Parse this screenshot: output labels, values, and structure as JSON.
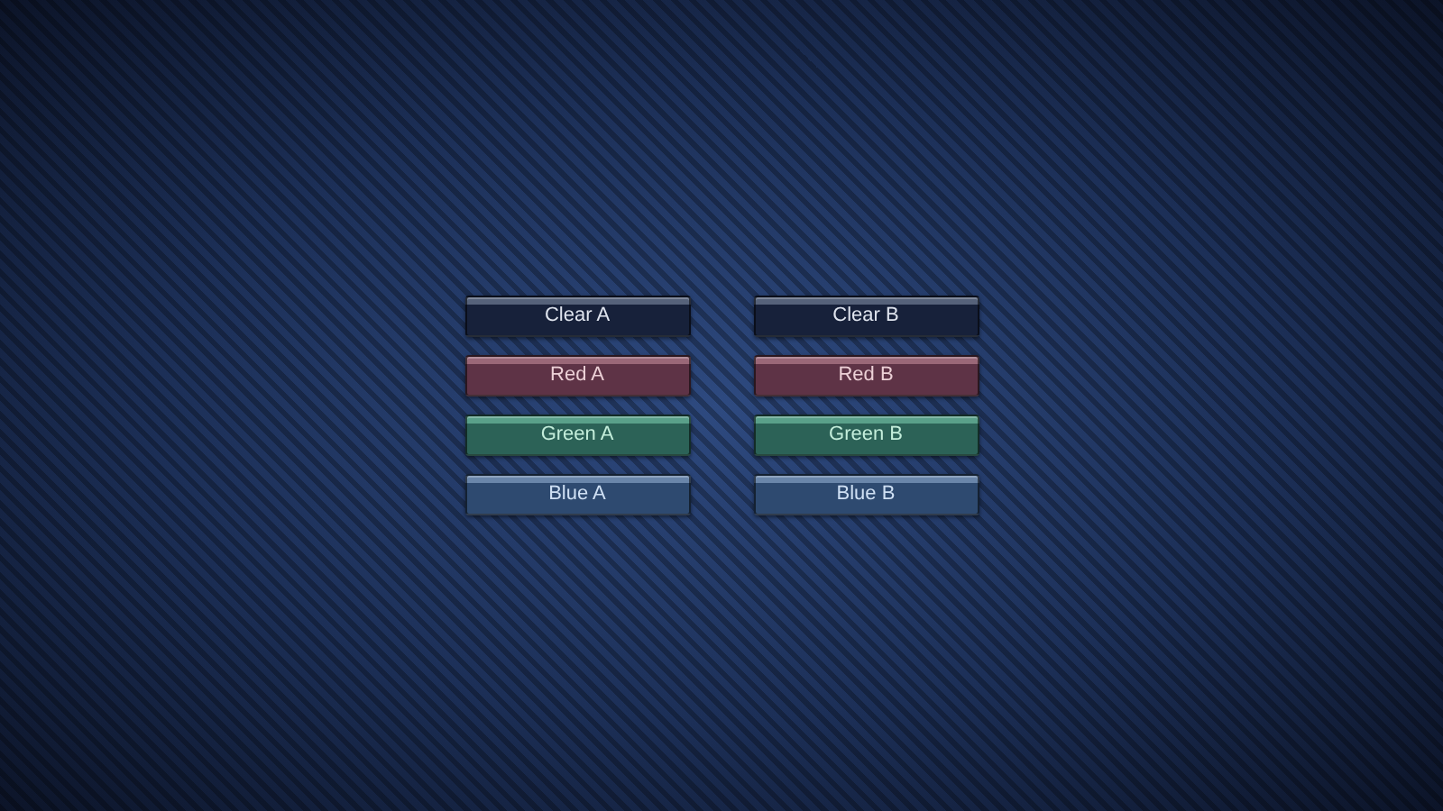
{
  "columns": [
    {
      "buttons": [
        {
          "label": "Clear A",
          "kind": "clear"
        },
        {
          "label": "Red A",
          "kind": "red"
        },
        {
          "label": "Green A",
          "kind": "green"
        },
        {
          "label": "Blue A",
          "kind": "blue"
        }
      ]
    },
    {
      "buttons": [
        {
          "label": "Clear B",
          "kind": "clear"
        },
        {
          "label": "Red B",
          "kind": "red"
        },
        {
          "label": "Green B",
          "kind": "green"
        },
        {
          "label": "Blue B",
          "kind": "blue"
        }
      ]
    }
  ]
}
